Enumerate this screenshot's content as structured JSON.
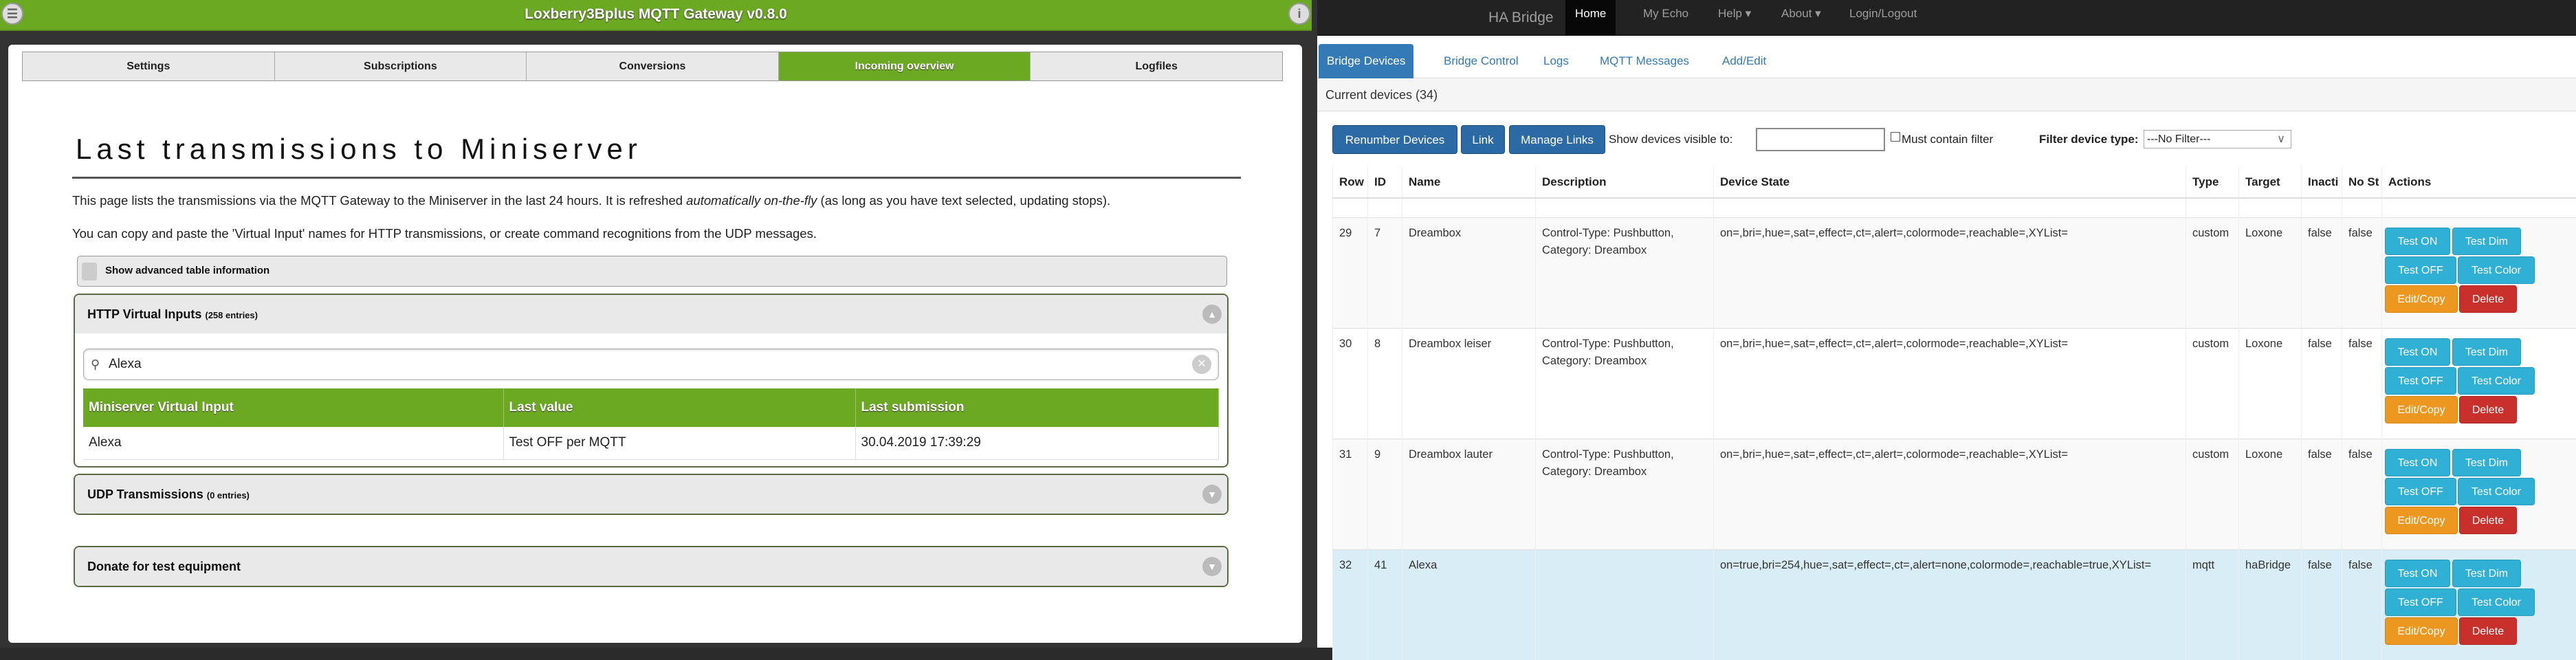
{
  "left": {
    "title": "Loxberry3Bplus MQTT Gateway v0.8.0",
    "tabs": [
      {
        "label": "Settings"
      },
      {
        "label": "Subscriptions"
      },
      {
        "label": "Conversions"
      },
      {
        "label": "Incoming overview"
      },
      {
        "label": "Logfiles"
      }
    ],
    "heading": "Last transmissions to Miniserver",
    "para1_a": "This page lists the transmissions via the MQTT Gateway to the Miniserver in the last 24 hours. It is refreshed ",
    "para1_em": "automatically on-the-fly",
    "para1_b": " (as long as you have text selected, updating stops).",
    "para2": "You can copy and paste the 'Virtual Input' names for HTTP transmissions, or create command recognitions from the UDP messages.",
    "advanced_label": "Show advanced table information",
    "http": {
      "title": "HTTP Virtual Inputs",
      "count": "(258 entries)",
      "search": "Alexa",
      "headers": [
        "Miniserver Virtual Input",
        "Last value",
        "Last submission"
      ],
      "rows": [
        [
          "Alexa",
          "Test OFF per MQTT",
          "30.04.2019 17:39:29"
        ]
      ]
    },
    "udp": {
      "title": "UDP Transmissions",
      "count": "(0 entries)"
    },
    "donate": {
      "title": "Donate for test equipment"
    }
  },
  "right": {
    "brand": "HA Bridge",
    "nav": [
      "Home",
      "My Echo",
      "Help ▾",
      "About ▾",
      "Login/Logout"
    ],
    "tabs": [
      "Bridge Devices",
      "Bridge Control",
      "Logs",
      "MQTT Messages",
      "Add/Edit"
    ],
    "current_devices": "Current devices (34)",
    "buttons": {
      "renumber": "Renumber Devices",
      "link": "Link",
      "manage": "Manage Links"
    },
    "visible_label": "Show devices visible to:",
    "visible_value": "",
    "must_contain": "Must contain filter",
    "filter_label": "Filter device type:",
    "filter_value": "---No Filter---",
    "headers": [
      "Row",
      "ID",
      "Name",
      "Description",
      "Device State",
      "Type",
      "Target",
      "Inacti",
      "No St",
      "Actions"
    ],
    "rows": [
      {
        "row": "29",
        "id": "7",
        "name": "Dreambox",
        "desc1": "Control-Type: Pushbutton,",
        "desc2": "Category: Dreambox",
        "state": "on=,bri=,hue=,sat=,effect=,ct=,alert=,colormode=,reachable=,XYList=",
        "type": "custom",
        "target": "Loxone",
        "inactive": "false",
        "nostate": "false"
      },
      {
        "row": "30",
        "id": "8",
        "name": "Dreambox leiser",
        "desc1": "Control-Type: Pushbutton,",
        "desc2": "Category: Dreambox",
        "state": "on=,bri=,hue=,sat=,effect=,ct=,alert=,colormode=,reachable=,XYList=",
        "type": "custom",
        "target": "Loxone",
        "inactive": "false",
        "nostate": "false"
      },
      {
        "row": "31",
        "id": "9",
        "name": "Dreambox lauter",
        "desc1": "Control-Type: Pushbutton,",
        "desc2": "Category: Dreambox",
        "state": "on=,bri=,hue=,sat=,effect=,ct=,alert=,colormode=,reachable=,XYList=",
        "type": "custom",
        "target": "Loxone",
        "inactive": "false",
        "nostate": "false"
      },
      {
        "row": "32",
        "id": "41",
        "name": "Alexa",
        "desc1": "",
        "desc2": "",
        "state": "on=true,bri=254,hue=,sat=,effect=,ct=,alert=none,colormode=,reachable=true,XYList=",
        "type": "mqtt",
        "target": "haBridge",
        "inactive": "false",
        "nostate": "false"
      }
    ],
    "actions": {
      "on": "Test ON",
      "dim": "Test Dim",
      "off": "Test OFF",
      "color": "Test Color",
      "edit": "Edit/Copy",
      "delete": "Delete"
    }
  }
}
